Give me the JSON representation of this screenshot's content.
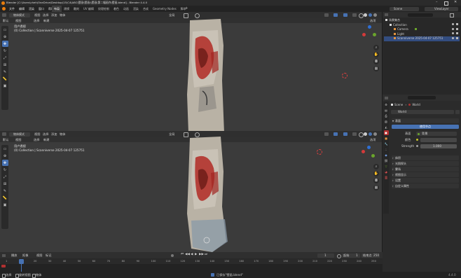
{
  "window": {
    "title": "Blender [C:\\Users\\cheh\\OneDrive\\Desktop\\15\\C4\\ABC\\壁画\\壁画\\\\壁画\\第二幅画作\\壁画.blend] - Blender 4.4.0",
    "app_icon": "blender-icon",
    "controls": [
      "minimize",
      "maximize",
      "close"
    ]
  },
  "menubar": {
    "menus": [
      "文件",
      "编辑",
      "渲染",
      "窗口",
      "帮助"
    ],
    "workspaces": [
      "布局",
      "建模",
      "雕刻",
      "UV 编辑",
      "纹理绘制",
      "着色",
      "动画",
      "渲染",
      "合成",
      "Geometry Nodes",
      "脚本"
    ],
    "active_workspace": "布局",
    "scene_label": "Scene",
    "view_layer_label": "ViewLayer"
  },
  "viewport_top": {
    "mode": "物体模式",
    "menus": [
      "视图",
      "选择",
      "添加",
      "物体"
    ],
    "orientation": "全局",
    "sub_menus": [
      "默认",
      "视图",
      "选择",
      "新建"
    ],
    "select_mode": "选项",
    "view_name": "用户透视",
    "collection_info": "(0) Collection | Scanniverse 2025-04-07 125751",
    "options_label": "选项"
  },
  "viewport_bottom": {
    "mode": "物体模式",
    "menus": [
      "视图",
      "选择",
      "添加",
      "物体"
    ],
    "orientation": "全局",
    "sub_menus": [
      "默认",
      "视图",
      "选择",
      "新建"
    ],
    "select_mode": "选项",
    "view_name": "用户透视",
    "collection_info": "(0) Collection | Scanniverse 2025-04-07 125751",
    "options_label": "选项"
  },
  "outliner": {
    "search_placeholder": "",
    "root": "场景集合",
    "items": [
      {
        "label": "Collection",
        "icon": "collection-icon",
        "indent": 1
      },
      {
        "label": "Camera",
        "icon": "camera-icon",
        "indent": 2
      },
      {
        "label": "Light",
        "icon": "light-icon",
        "indent": 2
      },
      {
        "label": "Scanniverse 2025-04-07 125751",
        "icon": "mesh-icon",
        "indent": 2,
        "selected": true
      }
    ]
  },
  "properties": {
    "search_placeholder": "",
    "breadcrumb_scene": "Scene",
    "breadcrumb_world": "World",
    "world_name": "World",
    "sections": {
      "surface": "表面",
      "use_nodes": "使用节点",
      "surface_label": "表面",
      "surface_value": "背景",
      "color_label": "颜色",
      "strength_label": "Strength",
      "strength_value": "1.000",
      "volume": "体积",
      "light_probe": "光照探头",
      "mist": "雾场",
      "viewport_display": "视图显示",
      "custom_props": "自定义属性",
      "settings": "设置"
    }
  },
  "timeline": {
    "menus": [
      "播放",
      "抠像",
      "视图",
      "标记"
    ],
    "current_frame": "1",
    "start_label": "起始",
    "start_value": "1",
    "end_label": "结束点",
    "end_value": "250",
    "ticks": [
      "1",
      "10",
      "20",
      "30",
      "40",
      "50",
      "60",
      "70",
      "80",
      "90",
      "100",
      "110",
      "120",
      "130",
      "140",
      "150",
      "160",
      "170",
      "180",
      "190",
      "200",
      "210",
      "220",
      "230",
      "240",
      "250"
    ]
  },
  "statusbar": {
    "left": [
      "选择",
      "旋转视图",
      "物体"
    ],
    "center": "已保存\"壁画.blend\"",
    "version": "4.4.0"
  },
  "colors": {
    "accent": "#4772b3",
    "selected_row": "#334d80",
    "mural_red": "#b22a25",
    "active_tool": "#4772b3"
  }
}
